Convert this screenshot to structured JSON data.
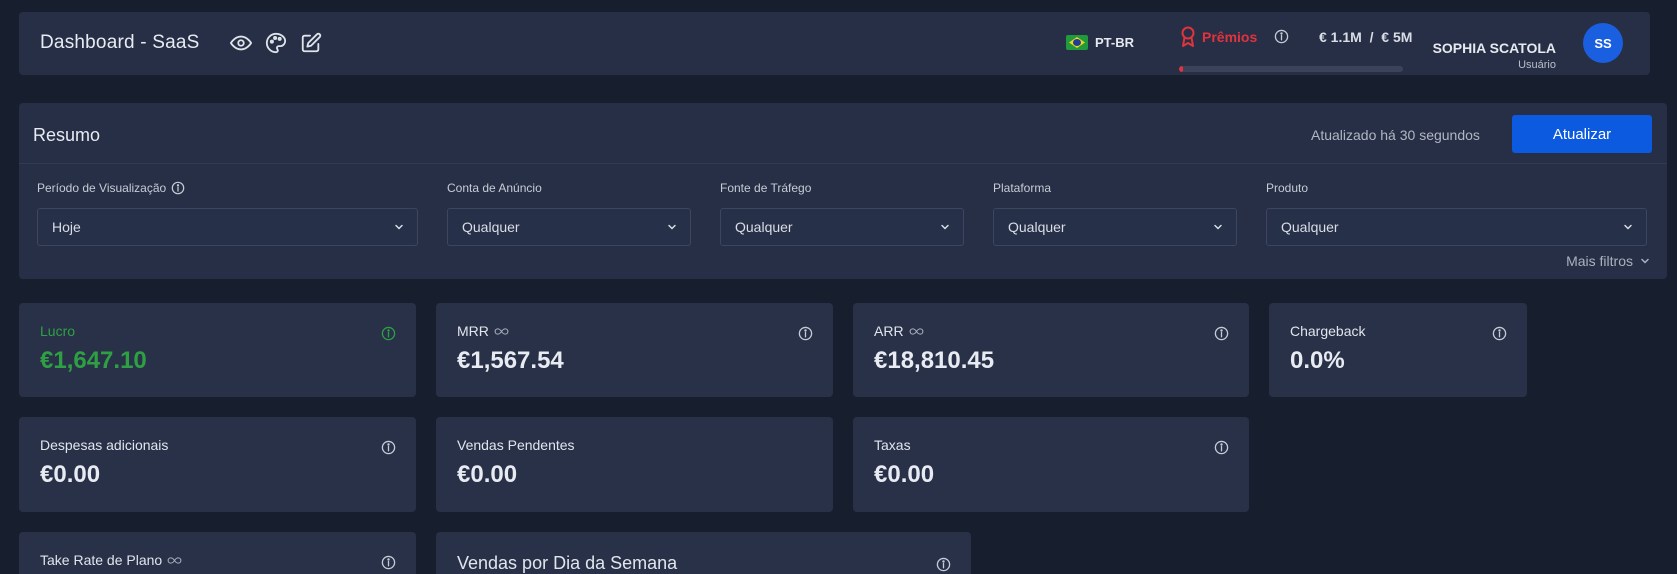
{
  "header": {
    "title": "Dashboard - SaaS",
    "language": "PT-BR",
    "awards": {
      "label": "Prêmios",
      "current": "€ 1.1M",
      "separator": "/",
      "goal": "€ 5M",
      "progress_percent": 2
    },
    "user": {
      "name": "SOPHIA SCATOLA",
      "role": "Usuário",
      "initials": "SS"
    }
  },
  "summary": {
    "title": "Resumo",
    "updated_text": "Atualizado há 30 segundos",
    "refresh_label": "Atualizar",
    "more_filters_label": "Mais filtros",
    "filters": [
      {
        "label": "Período de Visualização",
        "value": "Hoje"
      },
      {
        "label": "Conta de Anúncio",
        "value": "Qualquer"
      },
      {
        "label": "Fonte de Tráfego",
        "value": "Qualquer"
      },
      {
        "label": "Plataforma",
        "value": "Qualquer"
      },
      {
        "label": "Produto",
        "value": "Qualquer"
      }
    ]
  },
  "metrics": [
    {
      "label": "Lucro",
      "value": "€1,647.10"
    },
    {
      "label": "MRR",
      "value": "€1,567.54"
    },
    {
      "label": "ARR",
      "value": "€18,810.45"
    },
    {
      "label": "Chargeback",
      "value": "0.0%"
    },
    {
      "label": "Despesas adicionais",
      "value": "€0.00"
    },
    {
      "label": "Vendas Pendentes",
      "value": "€0.00"
    },
    {
      "label": "Taxas",
      "value": "€0.00"
    },
    {
      "label": "Take Rate de Plano",
      "value": ""
    }
  ],
  "sales_by_weekday": {
    "title": "Vendas por Dia da Semana"
  },
  "colors": {
    "background": "#171e2e",
    "panel": "#262f45",
    "accent": "#0b5ae0",
    "profit": "#2ea043",
    "award": "#e2333d"
  }
}
